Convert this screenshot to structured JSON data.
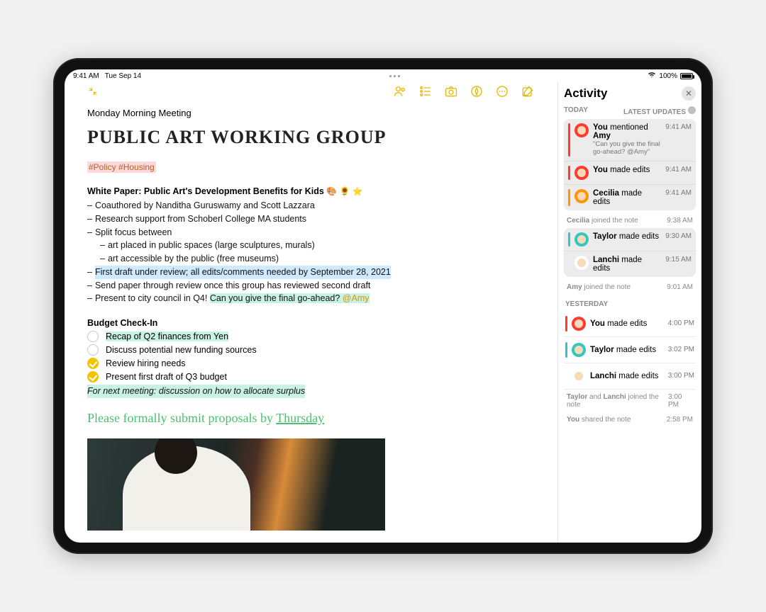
{
  "status": {
    "time": "9:41 AM",
    "date": "Tue Sep 14",
    "battery": "100%"
  },
  "note": {
    "label": "Monday Morning Meeting",
    "headline": "Public Art Working Group",
    "tags": "#Policy #Housing",
    "whitepaper_heading": "White Paper: Public Art's Development Benefits for Kids",
    "heading_emoji": "🎨 🌻 ⭐️",
    "lines": {
      "coauthored": "Coauthored by Nanditha Guruswamy and Scott Lazzara",
      "research": "Research support from Schoberl College MA students",
      "split": "Split focus between",
      "indent1": "art placed in public spaces (large sculptures, murals)",
      "indent2": "art accessible by the public (free museums)",
      "draft": "First draft under review; all edits/comments needed by September 28, 2021",
      "send": "Send paper through review once this group has reviewed second draft",
      "present_prefix": "Present to city council in Q4! ",
      "present_hl": "Can you give the final go-ahead? ",
      "present_mention": "@Amy"
    },
    "budget_heading": "Budget Check-In",
    "checks": [
      {
        "text": "Recap of Q2 finances from Yen",
        "done": false,
        "hl": true
      },
      {
        "text": "Discuss potential new funding sources",
        "done": false,
        "hl": false
      },
      {
        "text": "Review hiring needs",
        "done": true,
        "hl": false
      },
      {
        "text": "Present first draft of Q3 budget",
        "done": true,
        "hl": false
      }
    ],
    "italic_line": "For next meeting: discussion on how to allocate surplus",
    "hand_prefix": "Please formally submit proposals by ",
    "hand_underline": "Thursday"
  },
  "activity": {
    "title": "Activity",
    "today": "TODAY",
    "latest": "LATEST UPDATES",
    "yesterday": "YESTERDAY",
    "today_group": {
      "e0": {
        "line_b": "You",
        "line_rest": " mentioned ",
        "line_b2": "Amy",
        "sub": "\"Can you give the final go-ahead? @Amy\"",
        "time": "9:41 AM"
      },
      "e1": {
        "line_b": "You",
        "line_rest": " made edits",
        "time": "9:41 AM"
      },
      "e2": {
        "line_b": "Cecilia",
        "line_rest": " made edits",
        "time": "9:41 AM"
      }
    },
    "meta1": {
      "who": "Cecilia",
      "rest": " joined the note",
      "time": "9:38 AM"
    },
    "group2": {
      "e0": {
        "line_b": "Taylor",
        "line_rest": " made edits",
        "time": "9:30 AM"
      },
      "e1": {
        "line_b": "Lanchi",
        "line_rest": " made edits",
        "time": "9:15 AM"
      }
    },
    "meta2": {
      "who": "Amy",
      "rest": " joined the note",
      "time": "9:01 AM"
    },
    "yrows": {
      "r0": {
        "b": "You",
        "rest": " made edits",
        "time": "4:00 PM"
      },
      "r1": {
        "b": "Taylor",
        "rest": " made edits",
        "time": "3:02 PM"
      },
      "r2": {
        "b": "Lanchi",
        "rest": " made edits",
        "time": "3:00 PM"
      }
    },
    "ymeta1": {
      "text_a": "Taylor",
      "text_mid": " and ",
      "text_b": "Lanchi",
      "rest": " joined the note",
      "time": "3:00 PM"
    },
    "ymeta2": {
      "who": "You",
      "rest": " shared the note",
      "time": "2:58 PM"
    }
  }
}
